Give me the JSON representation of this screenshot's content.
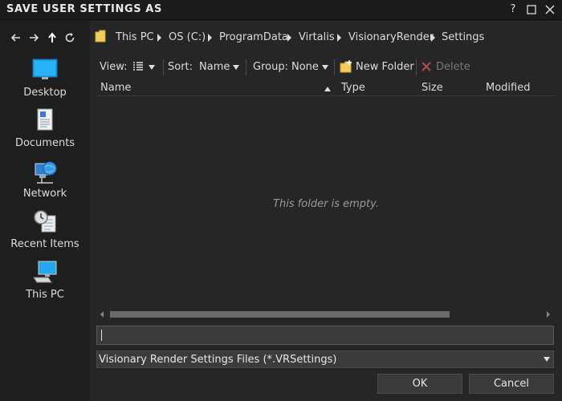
{
  "window": {
    "title": "SAVE USER SETTINGS AS",
    "help_label": "?",
    "maximize_label": "□",
    "close_label": "✕"
  },
  "nav": {
    "back_icon": "←",
    "forward_icon": "→",
    "up_icon": "↑",
    "refresh_icon": "↻"
  },
  "sidebar": {
    "items": [
      {
        "label": "Desktop",
        "icon": "desktop-icon"
      },
      {
        "label": "Documents",
        "icon": "documents-icon"
      },
      {
        "label": "Network",
        "icon": "network-icon"
      },
      {
        "label": "Recent Items",
        "icon": "recent-items-icon"
      },
      {
        "label": "This PC",
        "icon": "this-pc-icon"
      }
    ]
  },
  "breadcrumb": {
    "items": [
      "This PC",
      "OS (C:)",
      "ProgramData",
      "Virtalis",
      "VisionaryRender",
      "Settings"
    ]
  },
  "toolbar": {
    "view_label": "View:",
    "sort_label": "Sort:",
    "sort_value": "Name",
    "group_label": "Group:",
    "group_value": "None",
    "new_folder_label": "New Folder",
    "delete_label": "Delete"
  },
  "columns": {
    "name": "Name",
    "type": "Type",
    "size": "Size",
    "modified": "Modified"
  },
  "filelist": {
    "empty_message": "This folder is empty."
  },
  "filename": {
    "value": ""
  },
  "filetype": {
    "selected": "Visionary Render Settings Files (*.VRSettings)"
  },
  "buttons": {
    "ok": "OK",
    "cancel": "Cancel"
  },
  "colors": {
    "background": "#1e1e1e",
    "panel": "#262626",
    "input": "#3b3b3b",
    "folder": "#f2cf5b"
  }
}
